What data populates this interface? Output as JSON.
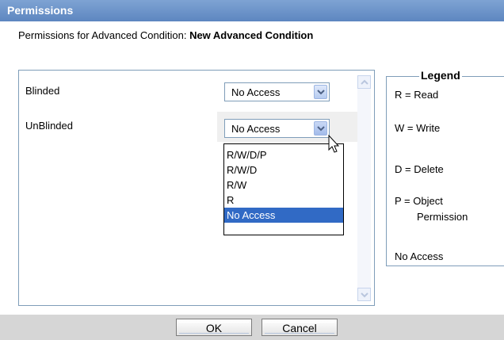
{
  "dialog": {
    "title": "Permissions",
    "subtitle_prefix": "Permissions for Advanced Condition: ",
    "subtitle_name": "New Advanced Condition"
  },
  "rows": [
    {
      "label": "Blinded",
      "value": "No Access"
    },
    {
      "label": "UnBlinded",
      "value": "No Access"
    }
  ],
  "dropdown": {
    "options": [
      "R/W/D/P",
      "R/W/D",
      "R/W",
      "R",
      "No Access"
    ],
    "selected": "No Access"
  },
  "legend": {
    "title": "Legend",
    "items": [
      "R = Read",
      "W = Write",
      "D = Delete",
      "P = Object",
      "Permission",
      "No Access"
    ]
  },
  "buttons": {
    "ok": "OK",
    "cancel": "Cancel"
  },
  "icons": {
    "dropdown_arrow": "chevron-down-icon",
    "scroll_up": "chevron-up-icon",
    "scroll_down": "chevron-down-icon",
    "cursor": "mouse-pointer-icon"
  },
  "colors": {
    "titlebar": "#6e95c9",
    "selected_option": "#316ac5",
    "footer": "#d6d6d6"
  }
}
